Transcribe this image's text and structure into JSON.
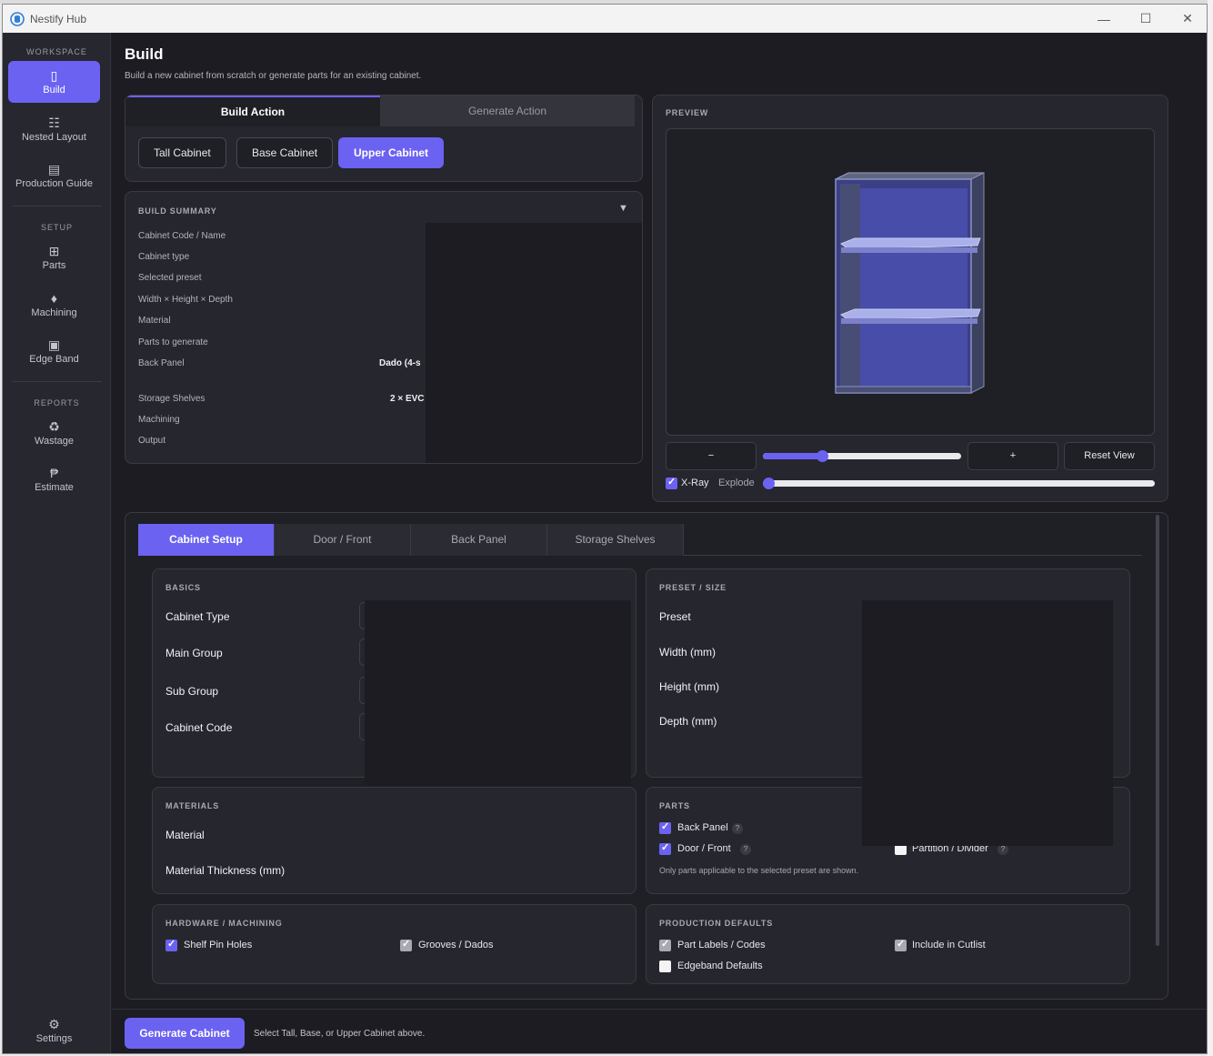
{
  "window": {
    "title": "Nestify Hub"
  },
  "sidebar": {
    "sections": [
      "WORKSPACE",
      "SETUP",
      "REPORTS"
    ],
    "items": [
      {
        "label": "Build",
        "icon": "cabinet-icon"
      },
      {
        "label": "Nested Layout",
        "icon": "grid-icon"
      },
      {
        "label": "Production Guide",
        "icon": "list-icon"
      },
      {
        "label": "Parts",
        "icon": "parts-icon"
      },
      {
        "label": "Machining",
        "icon": "machining-icon"
      },
      {
        "label": "Edge Band",
        "icon": "edge-band-icon"
      },
      {
        "label": "Wastage",
        "icon": "recycle-icon"
      },
      {
        "label": "Estimate",
        "icon": "peso-icon"
      }
    ],
    "settings": "Settings"
  },
  "page": {
    "title": "Build",
    "subtitle": "Build a new cabinet from scratch or generate parts for an existing cabinet."
  },
  "action_tabs": [
    "Build Action",
    "Generate Action"
  ],
  "cabinet_chips": [
    "Tall Cabinet",
    "Base Cabinet",
    "Upper Cabinet"
  ],
  "summary": {
    "caption": "BUILD SUMMARY",
    "rows": [
      "Cabinet Code / Name",
      "Cabinet type",
      "Selected preset",
      "Width × Height × Depth",
      "Material",
      "Parts to generate",
      "Back Panel",
      "Storage Shelves",
      "Machining",
      "Output"
    ],
    "back_panel_value": "Dado (4-s",
    "shelves_value": "2 × EVC"
  },
  "preview": {
    "caption": "PREVIEW",
    "zoom_out": "−",
    "zoom_in": "+",
    "reset": "Reset View",
    "zoom_level": 0.3,
    "xray_label": "X-Ray",
    "xray_checked": true,
    "explode_label": "Explode",
    "explode_level": 0
  },
  "setup_tabs": [
    "Cabinet Setup",
    "Door / Front",
    "Back Panel",
    "Storage Shelves"
  ],
  "basics": {
    "caption": "BASICS",
    "fields": [
      "Cabinet Type",
      "Main Group",
      "Sub Group",
      "Cabinet Code"
    ]
  },
  "preset_size": {
    "caption": "PRESET / SIZE",
    "fields": [
      "Preset",
      "Width (mm)",
      "Height (mm)",
      "Depth (mm)"
    ]
  },
  "materials": {
    "caption": "MATERIALS",
    "fields": [
      "Material",
      "Material Thickness (mm)"
    ]
  },
  "parts": {
    "caption": "PARTS",
    "items": [
      {
        "label": "Back Panel",
        "checked": true
      },
      {
        "label": "Door / Front",
        "checked": true
      },
      {
        "label": "Partition / Divider",
        "checked": false
      }
    ],
    "help": "?",
    "note": "Only parts applicable to the selected preset are shown."
  },
  "hardware": {
    "caption": "HARDWARE / MACHINING",
    "items": [
      {
        "label": "Shelf Pin Holes",
        "checked": true
      },
      {
        "label": "Grooves / Dados",
        "checked": true
      }
    ]
  },
  "production": {
    "caption": "PRODUCTION DEFAULTS",
    "items": [
      {
        "label": "Part Labels / Codes",
        "checked": true
      },
      {
        "label": "Include in Cutlist",
        "checked": true
      },
      {
        "label": "Edgeband Defaults",
        "checked": false
      }
    ]
  },
  "footer": {
    "button": "Generate Cabinet",
    "hint": "Select Tall, Base, or Upper Cabinet above."
  },
  "colors": {
    "accent": "#6b62f2",
    "background": "#1c1c22",
    "panel": "#26262e"
  }
}
